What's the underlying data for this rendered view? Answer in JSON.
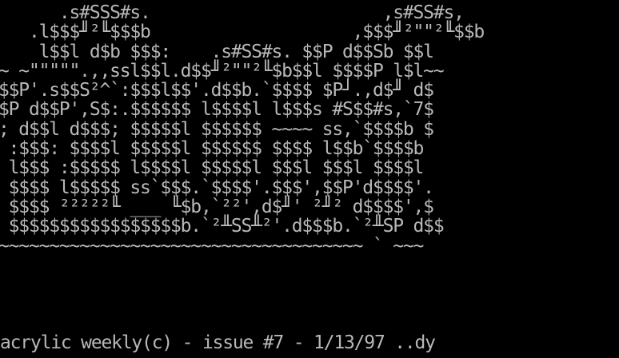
{
  "ansi_art": {
    "lines": [
      "      .s#SSS#s.                       ,s#SS#s,",
      "   .l$$$╜²╙$$$b                    ,$$$╜²\"\"²╙$$b",
      "    l$$l d$b $$$:    .s#SS#s. $$P d$$Sb $$l",
      "~ ~\"\"\"\"\".,,ssl$$l.d$$╜²\"\"²╙$b$$l $$$$P l$l~~",
      "$$P'.s$$S²^`:$$$l$$'.d$$b.`$$$$ $P┘.,d$╜ d$",
      "$P d$$P',S$:.$$$$$$ l$$$$l l$$$s #S$$#s,`7$",
      "; d$$l d$$$; $$$$$l $$$$$$ ~~~~ ss,`$$$$b $",
      " :$$$: $$$$l $$$$$l $$$$$$ $$$$ l$$b`$$$$b",
      " l$$$ :$$$$$ l$$$$l $$$$$l $$$l $$$l $$$$l",
      " $$$$ l$$$$$ ss`$$$.`$$$$'.$$$',$$P'd$$$$'.",
      " $$$$ ²²²²²╙ ___ ╙$b,`²²',d$╜' ²╜² d$$$$',$",
      " $$$$$$$$$$$$$$$$$b.`²╨SS╨²'.d$$$b.`²╨SP d$$",
      "~~~~~~~~~~~~~~~~~~~~~~~~~~~~~~~~~~~~ ` ~~~"
    ]
  },
  "footer": {
    "text": "acrylic weekly(c) - issue #7 - 1/13/97 ..dy"
  },
  "colors": {
    "background": "#000000",
    "foreground": "#b8b8b8"
  }
}
